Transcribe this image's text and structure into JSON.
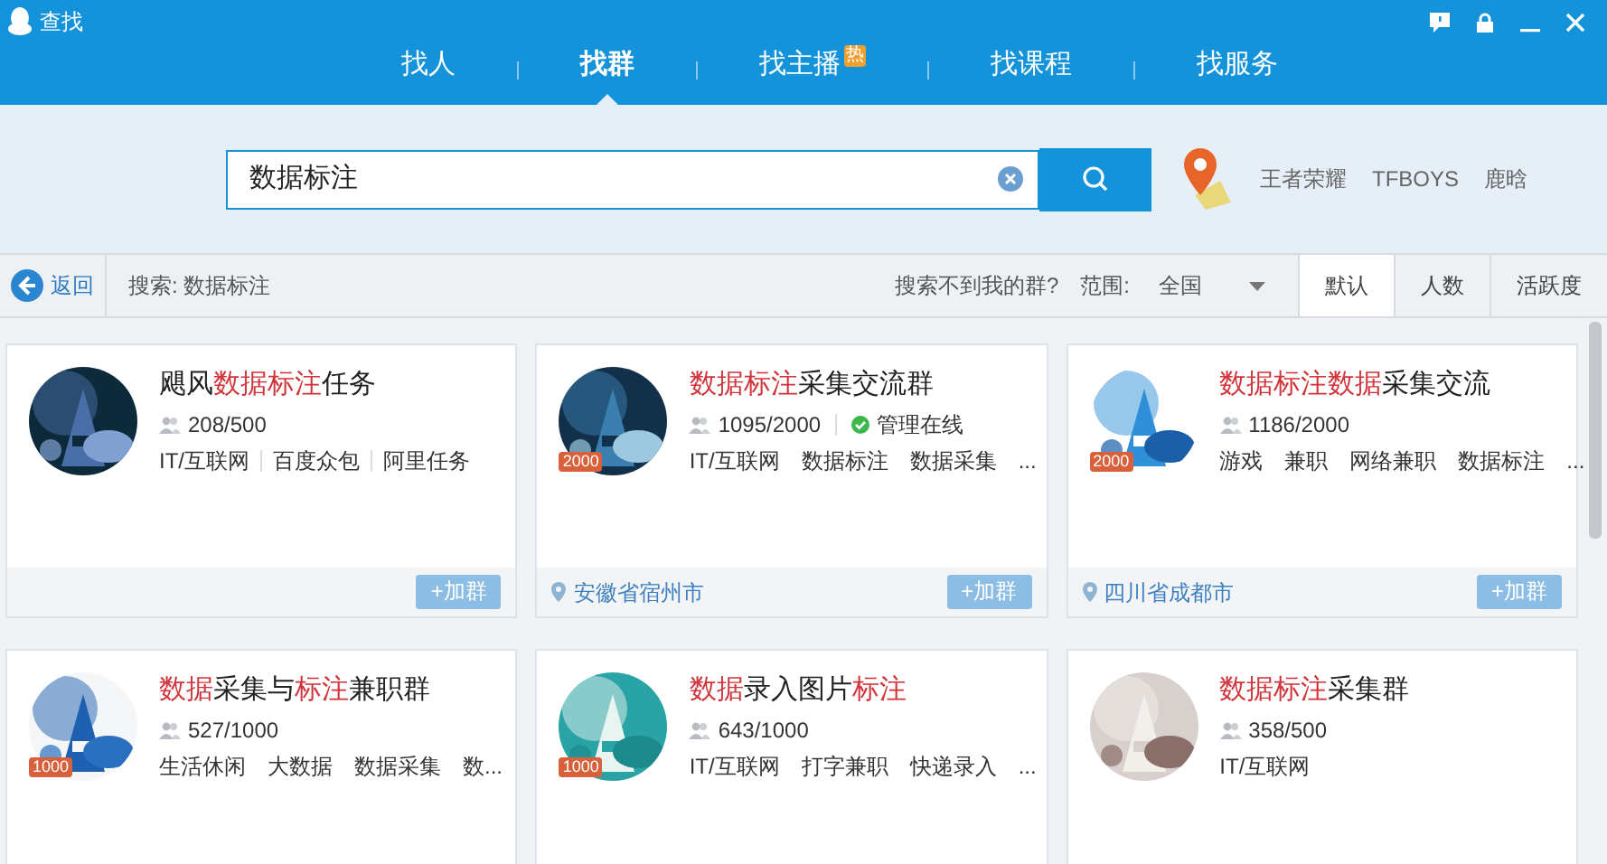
{
  "window": {
    "title": "查找"
  },
  "tabs": [
    {
      "label": "找人",
      "selected": false
    },
    {
      "label": "找群",
      "selected": true
    },
    {
      "label": "找主播",
      "selected": false,
      "badge": "热"
    },
    {
      "label": "找课程",
      "selected": false
    },
    {
      "label": "找服务",
      "selected": false
    }
  ],
  "search": {
    "value": "数据标注"
  },
  "hot_words": [
    "王者荣耀",
    "TFBOYS",
    "鹿晗"
  ],
  "toolbar": {
    "back": "返回",
    "query": "搜索: 数据标注",
    "not_found": "搜索不到我的群?",
    "scope_label": "范围:",
    "scope": "全国"
  },
  "sort_tabs": [
    {
      "label": "默认",
      "selected": true
    },
    {
      "label": "人数",
      "selected": false
    },
    {
      "label": "活跃度",
      "selected": false
    }
  ],
  "groups": [
    {
      "title": [
        {
          "text": "飓风",
          "highlight": false
        },
        {
          "text": "数据标注",
          "highlight": true
        },
        {
          "text": "任务",
          "highlight": false
        }
      ],
      "members": "208/500",
      "tags": [
        "IT/互联网",
        "百度众包",
        "阿里任务"
      ],
      "button": "+加群"
    },
    {
      "title": [
        {
          "text": "数据标注",
          "highlight": true
        },
        {
          "text": "采集交流群",
          "highlight": false
        }
      ],
      "badge": "2000",
      "members": "1095/2000",
      "status": "管理在线",
      "tags": [
        "IT/互联网",
        "数据标注",
        "数据采集",
        "..."
      ],
      "location": "安徽省宿州市",
      "button": "+加群"
    },
    {
      "title": [
        {
          "text": "数据标注数据",
          "highlight": true
        },
        {
          "text": "采集交流",
          "highlight": false
        }
      ],
      "badge": "2000",
      "members": "1186/2000",
      "tags": [
        "游戏",
        "兼职",
        "网络兼职",
        "数据标注",
        "..."
      ],
      "location": "四川省成都市",
      "button": "+加群"
    },
    {
      "title": [
        {
          "text": "数据",
          "highlight": true
        },
        {
          "text": "采集与",
          "highlight": false
        },
        {
          "text": "标注",
          "highlight": true
        },
        {
          "text": "兼职群",
          "highlight": false
        }
      ],
      "badge": "1000",
      "members": "527/1000",
      "tags": [
        "生活休闲",
        "大数据",
        "数据采集",
        "数..."
      ]
    },
    {
      "title": [
        {
          "text": "数据",
          "highlight": true
        },
        {
          "text": "录入图片",
          "highlight": false
        },
        {
          "text": "标注",
          "highlight": true
        }
      ],
      "badge": "1000",
      "members": "643/1000",
      "tags": [
        "IT/互联网",
        "打字兼职",
        "快递录入",
        "..."
      ]
    },
    {
      "title": [
        {
          "text": "数据标注",
          "highlight": true
        },
        {
          "text": "采集群",
          "highlight": false
        }
      ],
      "members": "358/500",
      "tags": [
        "IT/互联网"
      ]
    }
  ]
}
